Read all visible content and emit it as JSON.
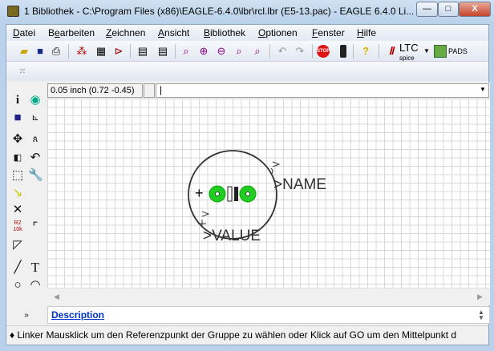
{
  "window": {
    "title": "1 Bibliothek - C:\\Program Files (x86)\\EAGLE-6.4.0\\lbr\\rcl.lbr (E5-13.pac) - EAGLE 6.4.0 Li...",
    "minimize": "—",
    "maximize": "□",
    "close": "X"
  },
  "menu": [
    {
      "pre": "",
      "u": "D",
      "post": "atei"
    },
    {
      "pre": "B",
      "u": "e",
      "post": "arbeiten"
    },
    {
      "pre": "",
      "u": "Z",
      "post": "eichnen"
    },
    {
      "pre": "",
      "u": "A",
      "post": "nsicht"
    },
    {
      "pre": "",
      "u": "B",
      "post": "ibliothek"
    },
    {
      "pre": "",
      "u": "O",
      "post": "ptionen"
    },
    {
      "pre": "",
      "u": "F",
      "post": "enster"
    },
    {
      "pre": "",
      "u": "H",
      "post": "ilfe"
    }
  ],
  "toolbar": {
    "ltc_label": "LTC",
    "ltc_sub": "spice",
    "pads_label": "PADS",
    "help": "?",
    "stop": "STOP"
  },
  "command": {
    "coordinate": "0.05 inch (0.72 -0.45)",
    "input_value": ""
  },
  "canvas": {
    "name_label": ">NAME",
    "value_label": ">VALUE",
    "origin": "+"
  },
  "palette": {
    "resistor_label": "R2",
    "resistor_value": "10k",
    "text_tool": "T"
  },
  "description": {
    "link": "Description"
  },
  "status": {
    "text": "♦ Linker Mausklick um den Referenzpunkt der Gruppe zu wählen oder Klick auf GO um den Mittelpunkt d"
  },
  "colors": {
    "pad": "#22cc22",
    "link": "#0033cc"
  }
}
